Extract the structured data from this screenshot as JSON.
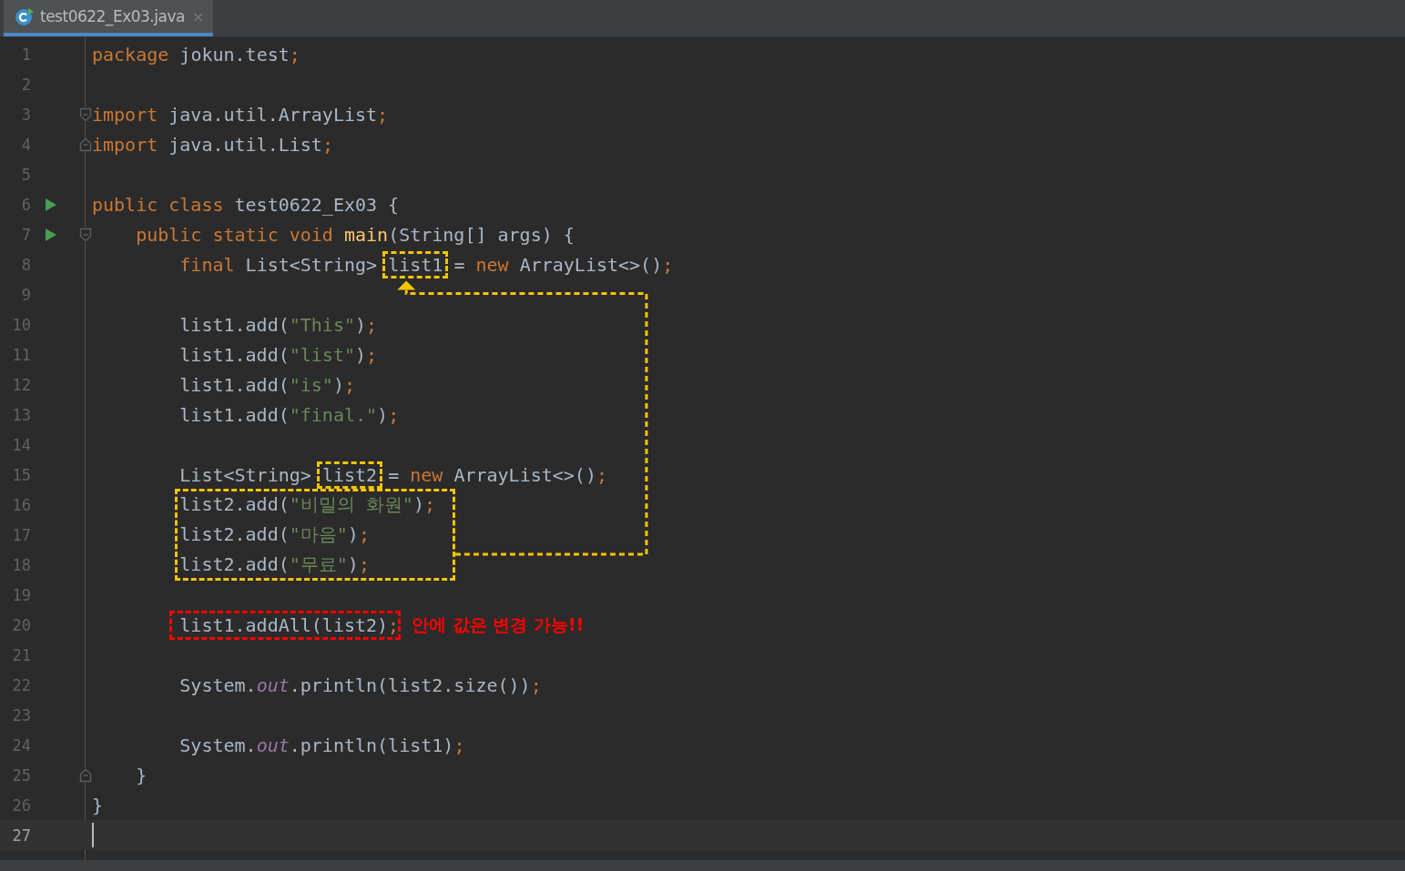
{
  "tabs": [
    {
      "label": "test0622_Ex03.java",
      "close": "×",
      "selected": true
    }
  ],
  "connector": {
    "color": "#f5c400"
  },
  "lines": [
    {
      "number": "1",
      "current": false,
      "code": [
        {
          "text": "package",
          "kind": "keyword"
        },
        {
          "text": " jokun.test",
          "kind": "plain"
        },
        {
          "text": ";",
          "kind": "keyword"
        }
      ]
    },
    {
      "number": "2",
      "current": false
    },
    {
      "number": "3",
      "current": false,
      "fold_start": true,
      "code": [
        {
          "text": "import",
          "kind": "keyword"
        },
        {
          "text": " java.util.ArrayList",
          "kind": "plain"
        },
        {
          "text": ";",
          "kind": "keyword"
        }
      ]
    },
    {
      "number": "4",
      "current": false,
      "fold_end": true,
      "code": [
        {
          "text": "import",
          "kind": "keyword"
        },
        {
          "text": " java.util.List",
          "kind": "plain"
        },
        {
          "text": ";",
          "kind": "keyword"
        }
      ]
    },
    {
      "number": "5",
      "current": false
    },
    {
      "number": "6",
      "current": false,
      "run": true,
      "code": [
        {
          "text": "public class",
          "kind": "keyword"
        },
        {
          "text": " test0622_Ex03 {",
          "kind": "plain"
        }
      ]
    },
    {
      "number": "7",
      "current": false,
      "run": true,
      "fold_start": true,
      "code": [
        {
          "text": "    public static void ",
          "kind": "keyword"
        },
        {
          "text": "main",
          "kind": "declaration"
        },
        {
          "text": "(String[] args) {",
          "kind": "plain"
        }
      ]
    },
    {
      "number": "8",
      "current": false,
      "code": [
        {
          "text": "        final",
          "kind": "keyword"
        },
        {
          "text": " List<String> ",
          "kind": "plain"
        },
        {
          "text": "list1",
          "kind": "plain",
          "color": "#f5c400"
        },
        {
          "text": " = ",
          "kind": "plain"
        },
        {
          "text": "new",
          "kind": "keyword"
        },
        {
          "text": " ArrayList<>()",
          "kind": "plain"
        },
        {
          "text": ";",
          "kind": "keyword"
        }
      ]
    },
    {
      "number": "9",
      "current": false
    },
    {
      "number": "10",
      "current": false,
      "code": [
        {
          "text": "        list1.add(",
          "kind": "plain"
        },
        {
          "text": "\"This\"",
          "kind": "string"
        },
        {
          "text": ")",
          "kind": "plain"
        },
        {
          "text": ";",
          "kind": "keyword"
        }
      ]
    },
    {
      "number": "11",
      "current": false,
      "code": [
        {
          "text": "        list1.add(",
          "kind": "plain"
        },
        {
          "text": "\"list\"",
          "kind": "string"
        },
        {
          "text": ")",
          "kind": "plain"
        },
        {
          "text": ";",
          "kind": "keyword"
        }
      ]
    },
    {
      "number": "12",
      "current": false,
      "code": [
        {
          "text": "        list1.add(",
          "kind": "plain"
        },
        {
          "text": "\"is\"",
          "kind": "string"
        },
        {
          "text": ")",
          "kind": "plain"
        },
        {
          "text": ";",
          "kind": "keyword"
        }
      ]
    },
    {
      "number": "13",
      "current": false,
      "code": [
        {
          "text": "        list1.add(",
          "kind": "plain"
        },
        {
          "text": "\"final.\"",
          "kind": "string"
        },
        {
          "text": ")",
          "kind": "plain"
        },
        {
          "text": ";",
          "kind": "keyword"
        }
      ]
    },
    {
      "number": "14",
      "current": false
    },
    {
      "number": "15",
      "current": false,
      "code": [
        {
          "text": "        List<String> ",
          "kind": "plain"
        },
        {
          "text": "list2",
          "kind": "plain",
          "color": "#f5c400"
        },
        {
          "text": " = ",
          "kind": "plain"
        },
        {
          "text": "new",
          "kind": "keyword"
        },
        {
          "text": " ArrayList<>()",
          "kind": "plain"
        },
        {
          "text": ";",
          "kind": "keyword"
        }
      ]
    },
    {
      "number": "16",
      "current": false,
      "color": "#f5c400",
      "code": [
        {
          "text": "        list2.add(",
          "kind": "plain"
        },
        {
          "text": "\"비밀의 화원\"",
          "kind": "string"
        },
        {
          "text": ")",
          "kind": "plain"
        },
        {
          "text": ";",
          "kind": "keyword"
        }
      ]
    },
    {
      "number": "17",
      "current": false,
      "color": "#f5c400",
      "code": [
        {
          "text": "        list2.add(",
          "kind": "plain"
        },
        {
          "text": "\"마음\"",
          "kind": "string"
        },
        {
          "text": ")",
          "kind": "plain"
        },
        {
          "text": ";",
          "kind": "keyword"
        }
      ]
    },
    {
      "number": "18",
      "current": false,
      "color": "#f5c400",
      "code": [
        {
          "text": "        list2.add(",
          "kind": "plain"
        },
        {
          "text": "\"무료\"",
          "kind": "string"
        },
        {
          "text": ")",
          "kind": "plain"
        },
        {
          "text": ";",
          "kind": "keyword"
        }
      ]
    },
    {
      "number": "19",
      "current": false
    },
    {
      "number": "20",
      "current": false,
      "color": "#ff0000",
      "note": "안에 값은 변경 가능!!",
      "code": [
        {
          "text": "        list1.addAll(list2)",
          "kind": "plain"
        },
        {
          "text": ";",
          "kind": "keyword"
        }
      ]
    },
    {
      "number": "21",
      "current": false
    },
    {
      "number": "22",
      "current": false,
      "code": [
        {
          "text": "        System.",
          "kind": "plain"
        },
        {
          "text": "out",
          "kind": "static-field"
        },
        {
          "text": ".println(list2.size())",
          "kind": "plain"
        },
        {
          "text": ";",
          "kind": "keyword"
        }
      ]
    },
    {
      "number": "23",
      "current": false
    },
    {
      "number": "24",
      "current": false,
      "code": [
        {
          "text": "        System.",
          "kind": "plain"
        },
        {
          "text": "out",
          "kind": "static-field"
        },
        {
          "text": ".println(list1)",
          "kind": "plain"
        },
        {
          "text": ";",
          "kind": "keyword"
        }
      ]
    },
    {
      "number": "25",
      "current": false,
      "fold_end": true,
      "code": [
        {
          "text": "    }",
          "kind": "plain"
        }
      ]
    },
    {
      "number": "26",
      "current": false,
      "code": [
        {
          "text": "}",
          "kind": "plain"
        }
      ]
    },
    {
      "number": "27",
      "current": true
    }
  ]
}
